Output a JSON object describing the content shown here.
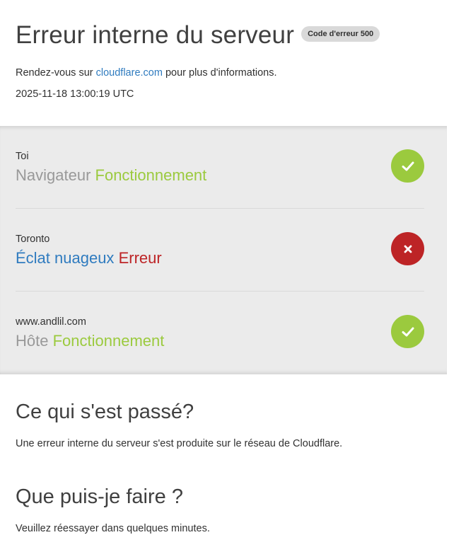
{
  "header": {
    "title": "Erreur interne du serveur",
    "code_badge": "Code d'erreur 500",
    "info_prefix": "Rendez-vous sur ",
    "info_link": "cloudflare.com",
    "info_suffix": " pour plus d'informations.",
    "timestamp": "2025-11-18 13:00:19 UTC"
  },
  "status": {
    "items": [
      {
        "location": "Toi",
        "name": "Navigateur",
        "state": "Fonctionnement",
        "state_kind": "ok",
        "icon": "check-icon"
      },
      {
        "location": "Toronto",
        "name": "Éclat nuageux",
        "state": "Erreur",
        "state_kind": "error",
        "icon": "x-icon"
      },
      {
        "location": "www.andlil.com",
        "name": "Hôte",
        "state": "Fonctionnement",
        "state_kind": "ok",
        "icon": "check-icon"
      }
    ]
  },
  "what_happened": {
    "heading": "Ce qui s'est passé?",
    "text": "Une erreur interne du serveur s'est produite sur le réseau de Cloudflare."
  },
  "what_can_i_do": {
    "heading": "Que puis-je faire ?",
    "text": "Veuillez réessayer dans quelques minutes."
  },
  "colors": {
    "ok": "#9bca3e",
    "error": "#bd2426",
    "link": "#2f7bbf",
    "panel": "#ebebeb"
  }
}
